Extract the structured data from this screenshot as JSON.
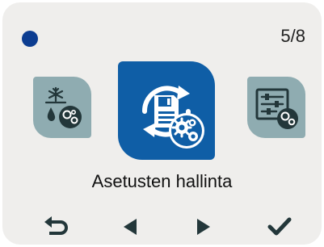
{
  "status": {
    "indicator_color": "#0c3d91"
  },
  "page_counter": "5/8",
  "carousel": {
    "items": [
      {
        "icon": "defrost-settings-icon",
        "state": "previous"
      },
      {
        "icon": "settings-backup-icon",
        "state": "selected"
      },
      {
        "icon": "adjustment-settings-icon",
        "state": "next"
      }
    ],
    "selected_title": "Asetusten hallinta"
  },
  "nav": {
    "buttons": [
      {
        "icon": "back-arrow-icon"
      },
      {
        "icon": "arrow-left-icon"
      },
      {
        "icon": "arrow-right-icon"
      },
      {
        "icon": "checkmark-icon"
      }
    ]
  },
  "colors": {
    "screen_bg": "#efeeec",
    "accent": "#0f5ea6",
    "side_tile": "#8facb1",
    "icon_dark": "#23373a"
  }
}
